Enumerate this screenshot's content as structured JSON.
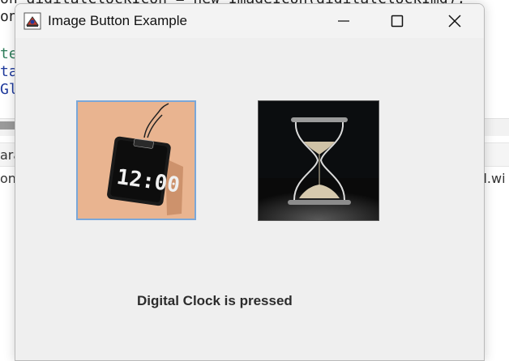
{
  "background": {
    "code_lines": [
      "on digitalClockIcon = new ImageIcon(digitalClockImg);",
      "on",
      "",
      "te",
      "ta",
      "Gl"
    ],
    "panel_left_1": "ara",
    "panel_left_2": "on",
    "panel_right": "ll.wi"
  },
  "window": {
    "title": "Image Button Example",
    "buttons": [
      {
        "label": "Digital Clock",
        "icon": "digital-clock-image"
      },
      {
        "label": "Hourglass",
        "icon": "hourglass-image"
      }
    ],
    "status_text": "Digital Clock is pressed"
  },
  "colors": {
    "window_bg": "#efefef",
    "clock_bg": "#e8b38f",
    "hourglass_bg": "#0d0d0d",
    "focus_border": "#7aa7d8"
  }
}
